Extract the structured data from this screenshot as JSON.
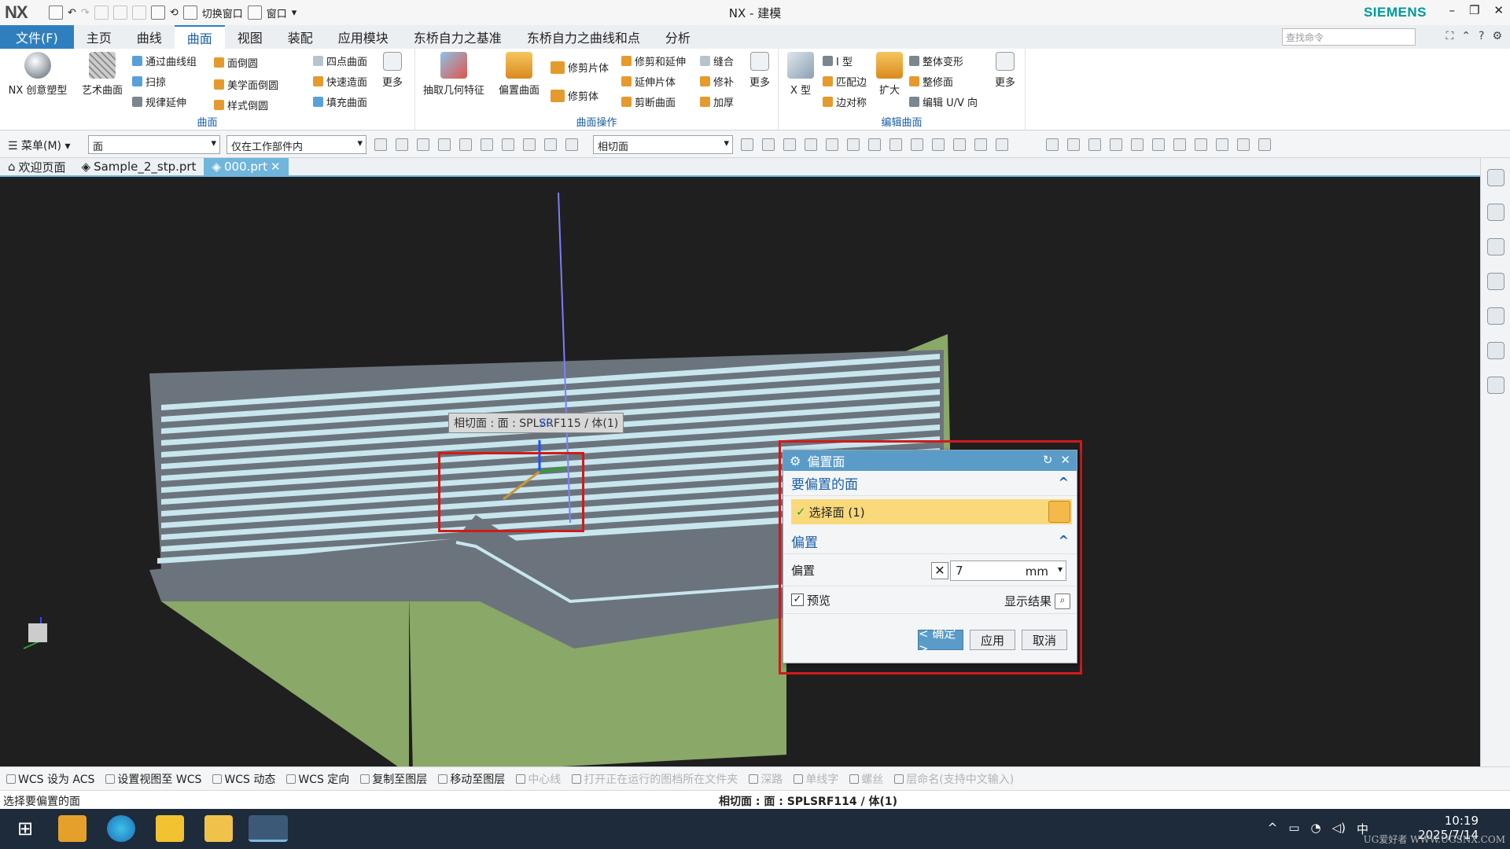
{
  "titlebar": {
    "logo": "NX",
    "switch_window": "切换窗口",
    "window_menu": "窗口",
    "title": "NX - 建模",
    "brand": "SIEMENS"
  },
  "tabs": [
    {
      "label": "文件(F)"
    },
    {
      "label": "主页"
    },
    {
      "label": "曲线"
    },
    {
      "label": "曲面"
    },
    {
      "label": "视图"
    },
    {
      "label": "装配"
    },
    {
      "label": "应用模块"
    },
    {
      "label": "东桥自力之基准"
    },
    {
      "label": "东桥自力之曲线和点"
    },
    {
      "label": "分析"
    }
  ],
  "search": {
    "placeholder": "查找命令"
  },
  "ribbon": {
    "group1": {
      "label": "曲面",
      "nx_creative": "NX 创意塑型",
      "art_surface": "艺术曲面",
      "through_curves": "通过曲线组",
      "sweep": "扫掠",
      "law_extend": "规律延伸",
      "face_blend": "面倒圆",
      "aesthetic_blend": "美学面倒圆",
      "style_blend": "样式倒圆",
      "four_point": "四点曲面",
      "rapid_surface": "快速造面",
      "fill_surface": "填充曲面",
      "more": "更多"
    },
    "group2": {
      "label": "曲面操作",
      "extract": "抽取几何特征",
      "offset_surface": "偏置曲面",
      "trim_sheet": "修剪片体",
      "trim_body": "修剪体",
      "trim_extend": "修剪和延伸",
      "extend_sheet": "延伸片体",
      "trim_surface": "剪断曲面",
      "sew": "缝合",
      "patch": "修补",
      "thicken": "加厚",
      "more": "更多"
    },
    "group3": {
      "label": "编辑曲面",
      "x_form": "X 型",
      "i_form": "I 型",
      "match_edge": "匹配边",
      "symmetric": "边对称",
      "enlarge": "扩大",
      "global_shaping": "整体变形",
      "refit": "整修面",
      "edit_uv": "编辑 U/V 向",
      "more": "更多"
    }
  },
  "selbar": {
    "menu": "菜单(M)",
    "filter": "面",
    "scope": "仅在工作部件内",
    "face_rule": "相切面"
  },
  "doc_tabs": [
    {
      "label": "欢迎页面"
    },
    {
      "label": "Sample_2_stp.prt"
    },
    {
      "label": "000.prt"
    }
  ],
  "viewport": {
    "tooltip": "相切面 : 面 : SPLSRF115 / 体(1)",
    "zc_label": "ZC",
    "colors": {
      "body_top": "#8c959d",
      "body_side": "#6b747c",
      "base": "#8aa868",
      "bg": "#1f1f1f"
    }
  },
  "dialog": {
    "title": "偏置面",
    "section_faces": "要偏置的面",
    "select_face": "选择面 (1)",
    "section_offset": "偏置",
    "offset_label": "偏置",
    "offset_value": "7",
    "offset_unit": "mm",
    "preview": "预览",
    "show_result": "显示结果",
    "ok": "< 确定 >",
    "apply": "应用",
    "cancel": "取消"
  },
  "cmdbar": [
    {
      "label": "WCS 设为 ACS",
      "enabled": true
    },
    {
      "label": "设置视图至 WCS",
      "enabled": true
    },
    {
      "label": "WCS 动态",
      "enabled": true
    },
    {
      "label": "WCS 定向",
      "enabled": true
    },
    {
      "label": "复制至图层",
      "enabled": true
    },
    {
      "label": "移动至图层",
      "enabled": true
    },
    {
      "label": "中心线",
      "enabled": false
    },
    {
      "label": "打开正在运行的图档所在文件夹",
      "enabled": false
    },
    {
      "label": "深路",
      "enabled": false
    },
    {
      "label": "单线字",
      "enabled": false
    },
    {
      "label": "螺丝",
      "enabled": false
    },
    {
      "label": "层命名(支持中文输入)",
      "enabled": false
    }
  ],
  "status": {
    "prompt": "选择要偏置的面",
    "info": "相切面 : 面 : SPLSRF114 / 体(1)"
  },
  "taskbar": {
    "time": "10:19",
    "date": "2025/7/14",
    "ime": "中",
    "watermark": "UG爱好者 WWW.UGSNX.COM"
  }
}
